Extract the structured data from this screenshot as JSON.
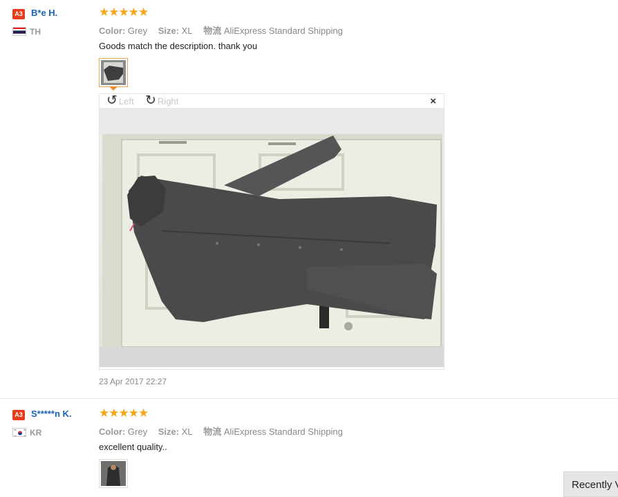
{
  "reviews": [
    {
      "badge": "A3",
      "name": "B*e H.",
      "country": "TH",
      "stars": "★★★★★",
      "color_label": "Color:",
      "color_value": "Grey",
      "size_label": "Size:",
      "size_value": "XL",
      "shipping_label": "物流",
      "shipping_value": "AliExpress Standard Shipping",
      "comment": "Goods match the description. thank you",
      "date": "23 Apr 2017 22:27"
    },
    {
      "badge": "A3",
      "name": "S*****n K.",
      "country": "KR",
      "stars": "★★★★★",
      "color_label": "Color:",
      "color_value": "Grey",
      "size_label": "Size:",
      "size_value": "XL",
      "shipping_label": "物流",
      "shipping_value": "AliExpress Standard Shipping",
      "comment": "excellent quality.."
    }
  ],
  "viewer": {
    "rotate_left_icon": "↺",
    "rotate_left_label": "Left",
    "rotate_right_icon": "↻",
    "rotate_right_label": "Right",
    "close_icon": "×"
  },
  "recently_viewed_label": "Recently Viewed",
  "colors": {
    "star": "#f3a619",
    "username": "#1a62b7",
    "badge": "#e43c1c"
  }
}
